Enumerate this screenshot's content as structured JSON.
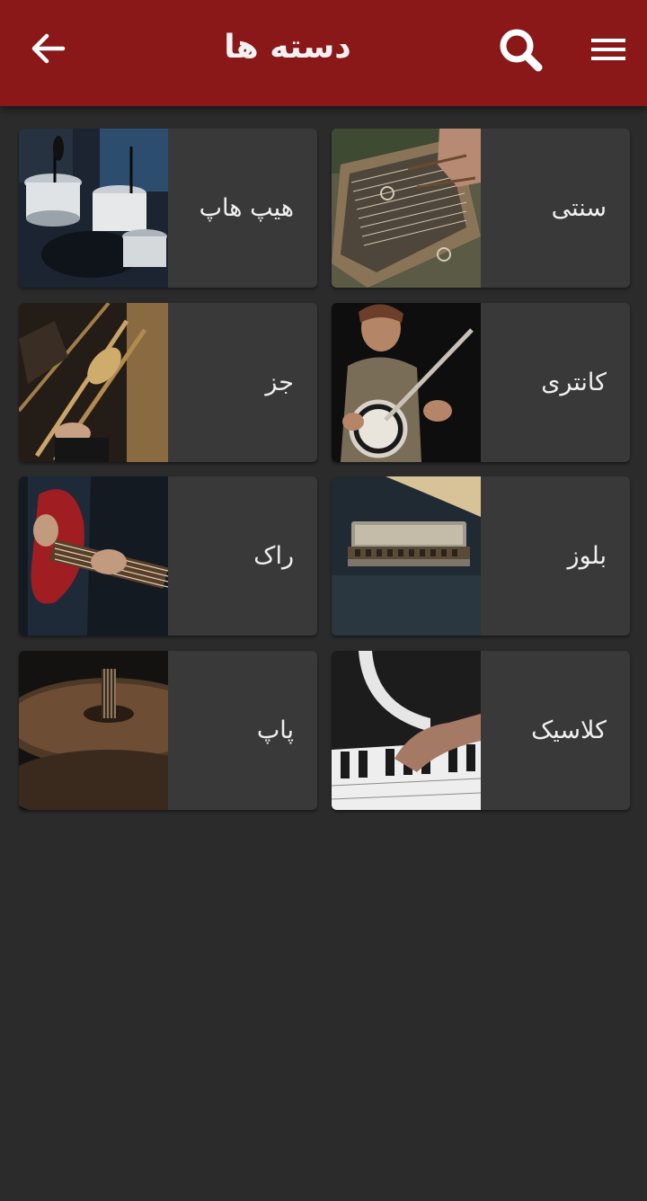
{
  "app_bar": {
    "title": "دسته ها",
    "back_icon": "arrow-left-icon",
    "search_icon": "search-icon",
    "menu_icon": "hamburger-menu-icon",
    "color": "#8b1818"
  },
  "categories": [
    {
      "label": "سنتی",
      "image": "santoor-image"
    },
    {
      "label": "هیپ هاپ",
      "image": "drum-kit-image"
    },
    {
      "label": "کانتری",
      "image": "banjo-player-image"
    },
    {
      "label": "جز",
      "image": "trombone-image"
    },
    {
      "label": "بلوز",
      "image": "harmonica-image"
    },
    {
      "label": "راک",
      "image": "electric-bass-image"
    },
    {
      "label": "کلاسیک",
      "image": "piano-keys-image"
    },
    {
      "label": "پاپ",
      "image": "acoustic-guitar-image"
    }
  ],
  "colors": {
    "background": "#2b2b2b",
    "card": "#3a393a",
    "text": "#f0f0f0"
  }
}
